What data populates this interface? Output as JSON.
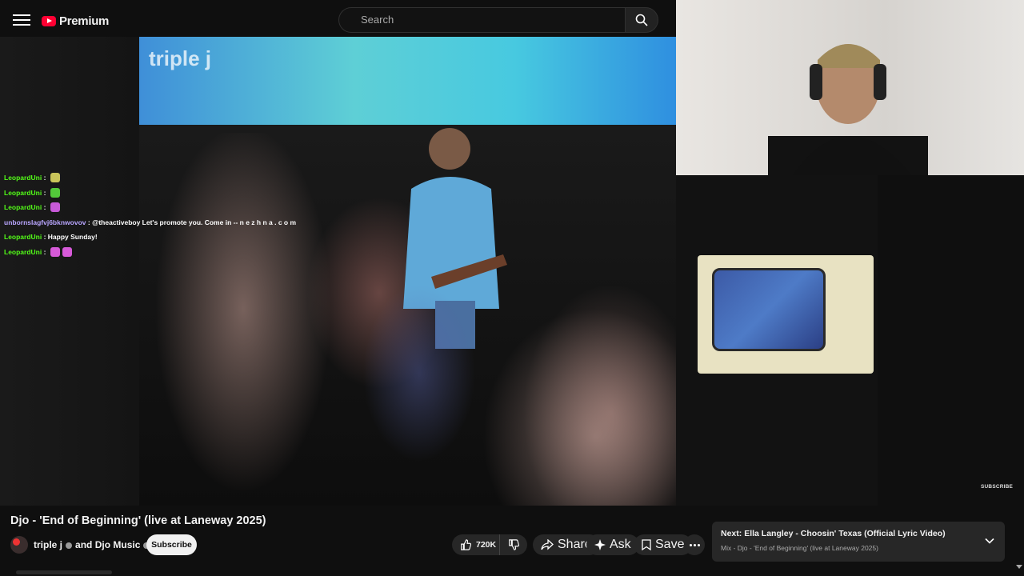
{
  "header": {
    "logo_text": "Premium",
    "search_placeholder": "Search"
  },
  "video": {
    "watermark": "triple j",
    "subscribe_watermark": "SUBSCRIBE"
  },
  "chat": [
    {
      "user": "LeopardUni",
      "message": "",
      "emotes": [
        "#c9c45a"
      ]
    },
    {
      "user": "LeopardUni",
      "message": "",
      "emotes": [
        "#53c93a"
      ]
    },
    {
      "user": "LeopardUni",
      "message": "",
      "emotes": [
        "#c85ad8"
      ]
    },
    {
      "user": "unbornslagfvj6bknwovov",
      "message": "@theactiveboy Let's promote you. Come in -- n e z h n a . c o m",
      "emotes": []
    },
    {
      "user": "LeopardUni",
      "message": "Happy Sunday!",
      "emotes": []
    },
    {
      "user": "LeopardUni",
      "message": "",
      "emotes": [
        "#d65ad8",
        "#d65ad8"
      ]
    }
  ],
  "title": "Djo - 'End of Beginning' (live at Laneway 2025)",
  "channel": {
    "name_1": "triple j",
    "connector": "and",
    "name_2": "Djo Music"
  },
  "subscribe_label": "Subscribe",
  "actions": {
    "like_count": "720K",
    "share_label": "Share",
    "ask_label": "Ask",
    "save_label": "Save"
  },
  "next": {
    "label": "Next:",
    "title": "Ella Langley - Choosin' Texas (Official Lyric Video)",
    "subtitle": "Mix - Djo - 'End of Beginning' (live at Laneway 2025)"
  },
  "colors": {
    "chat_user": "#53fc18",
    "chat_user_alt": "#b9a6ff",
    "brand_red": "#ff0033"
  }
}
